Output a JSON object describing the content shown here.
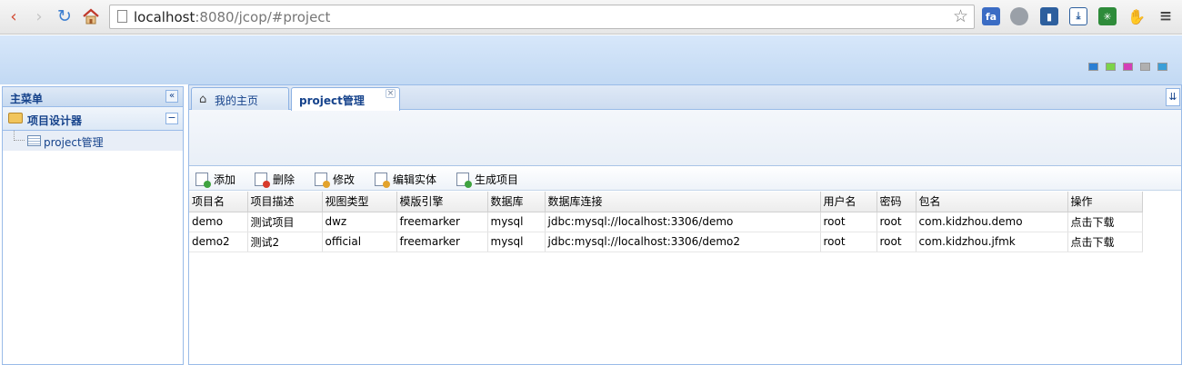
{
  "browser": {
    "url_host": "localhost",
    "url_path": ":8080/jcop/#project"
  },
  "left_panel": {
    "title": "主菜单",
    "collapse_glyph": "«",
    "accordion_title": "项目设计器",
    "accordion_glyph": "−",
    "tree_items": [
      {
        "label": "project管理"
      }
    ]
  },
  "tabs": [
    {
      "label": "我的主页",
      "icon": "home-icon"
    },
    {
      "label": "project管理",
      "active": true
    }
  ],
  "toolbar": {
    "buttons": [
      {
        "label": "添加",
        "icon": "add-icon"
      },
      {
        "label": "删除",
        "icon": "delete-icon"
      },
      {
        "label": "修改",
        "icon": "edit-icon"
      },
      {
        "label": "编辑实体",
        "icon": "edit-entity-icon"
      },
      {
        "label": "生成项目",
        "icon": "generate-icon"
      }
    ]
  },
  "grid": {
    "columns": [
      "项目名",
      "项目描述",
      "视图类型",
      "模版引擎",
      "数据库",
      "数据库连接",
      "用户名",
      "密码",
      "包名",
      "操作"
    ],
    "rows": [
      [
        "demo",
        "测试项目",
        "dwz",
        "freemarker",
        "mysql",
        "jdbc:mysql://localhost:3306/demo",
        "root",
        "root",
        "com.kidzhou.demo",
        "点击下载"
      ],
      [
        "demo2",
        "测试2",
        "official",
        "freemarker",
        "mysql",
        "jdbc:mysql://localhost:3306/demo2",
        "root",
        "root",
        "com.kidzhou.jfmk",
        "点击下载"
      ]
    ]
  },
  "theme_colors": [
    "#2a7fd4",
    "#7cd44a",
    "#d43fb8",
    "#b0b0b0",
    "#3a9fd8"
  ]
}
